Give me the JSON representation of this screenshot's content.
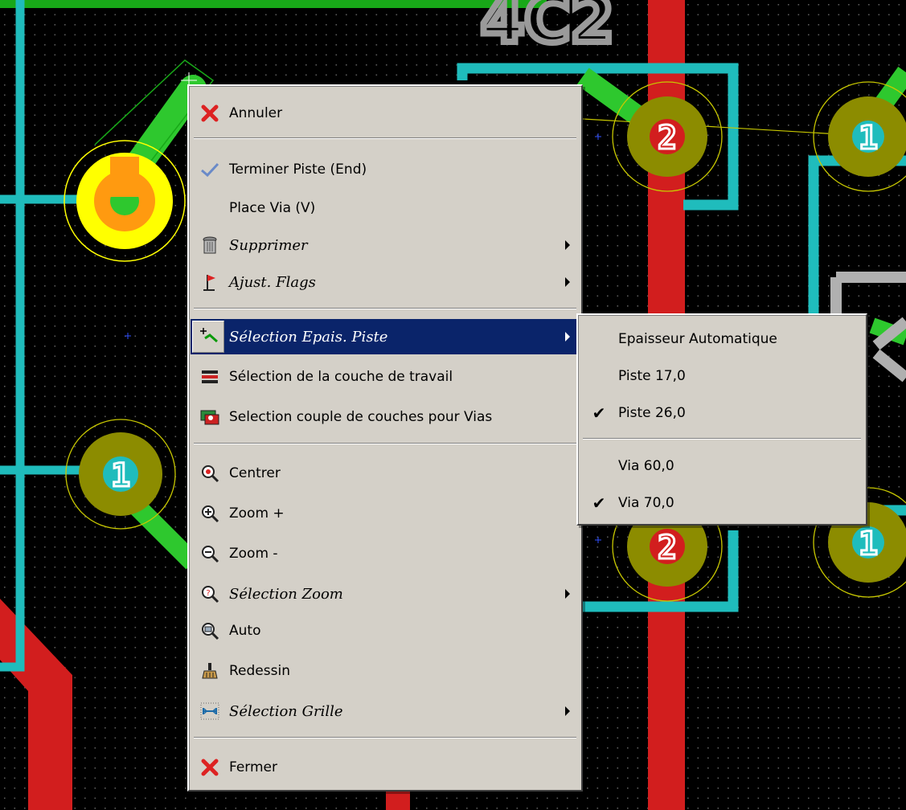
{
  "main_menu": {
    "items": [
      {
        "label": "Annuler",
        "icon": "red-x-icon",
        "italic": false,
        "submenu": false
      },
      {
        "label": "Terminer Piste (End)",
        "icon": "checkmark-icon",
        "italic": false,
        "submenu": false
      },
      {
        "label": "Place Via (V)",
        "icon": "",
        "italic": false,
        "submenu": false
      },
      {
        "label": "Supprimer",
        "icon": "trash-can-icon",
        "italic": true,
        "submenu": true
      },
      {
        "label": "Ajust. Flags",
        "icon": "flag-icon",
        "italic": true,
        "submenu": true
      },
      {
        "label": "Sélection Epais. Piste",
        "icon": "track-width-icon",
        "italic": true,
        "submenu": true
      },
      {
        "label": "Sélection de la couche de travail",
        "icon": "layers-icon",
        "italic": false,
        "submenu": false
      },
      {
        "label": "Selection couple de couches pour Vias",
        "icon": "via-layer-pair-icon",
        "italic": false,
        "submenu": false
      },
      {
        "label": "Centrer",
        "icon": "zoom-center-icon",
        "italic": false,
        "submenu": false
      },
      {
        "label": "Zoom +",
        "icon": "zoom-in-icon",
        "italic": false,
        "submenu": false
      },
      {
        "label": "Zoom -",
        "icon": "zoom-out-icon",
        "italic": false,
        "submenu": false
      },
      {
        "label": "Sélection Zoom",
        "icon": "zoom-select-icon",
        "italic": true,
        "submenu": true
      },
      {
        "label": "Auto",
        "icon": "zoom-auto-icon",
        "italic": false,
        "submenu": false
      },
      {
        "label": "Redessin",
        "icon": "redraw-brush-icon",
        "italic": false,
        "submenu": false
      },
      {
        "label": "Sélection Grille",
        "icon": "grid-select-icon",
        "italic": true,
        "submenu": true
      },
      {
        "label": "Fermer",
        "icon": "red-x-icon",
        "italic": false,
        "submenu": false
      }
    ],
    "selected_index": 5
  },
  "sub_menu": {
    "items": [
      {
        "label": "Epaisseur Automatique",
        "checked": false
      },
      {
        "label": "Piste 17,0",
        "checked": false
      },
      {
        "label": "Piste 26,0",
        "checked": true
      },
      {
        "label": "Via 60,0",
        "checked": false
      },
      {
        "label": "Via 70,0",
        "checked": true
      }
    ]
  },
  "board": {
    "silkscreen_text": "4C2",
    "pad_labels": [
      "2",
      "2",
      "1",
      "1",
      "1"
    ],
    "colors": {
      "background": "#000000",
      "grid_dot": "#4a4a4a",
      "copper_top_track": "#1fbcbc",
      "copper_bottom_track": "#d21e1e",
      "green_track": "#2ec82e",
      "pad_ring": "#8c8c00",
      "selected_pad": "#ffff00",
      "menu_bg": "#d4d0c8",
      "menu_highlight": "#0a246a"
    }
  }
}
